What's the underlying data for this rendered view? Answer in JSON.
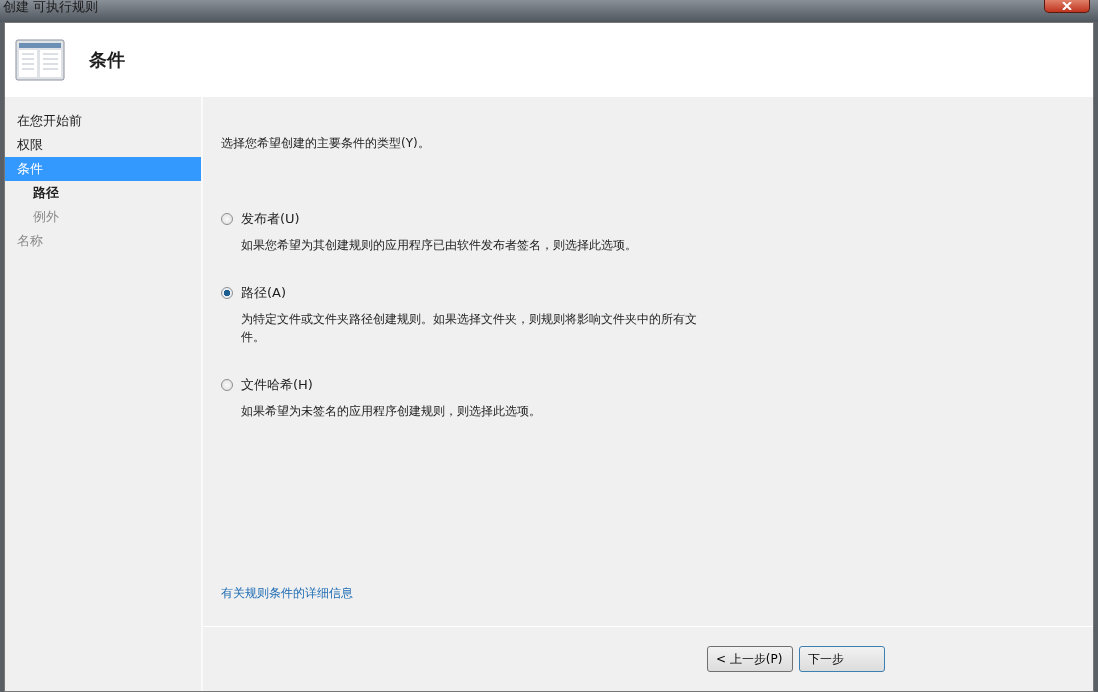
{
  "window": {
    "title": "创建 可执行规则"
  },
  "header": {
    "title": "条件"
  },
  "sidebar": {
    "items": [
      {
        "label": "在您开始前",
        "selected": false,
        "disabled": false,
        "current": false
      },
      {
        "label": "权限",
        "selected": false,
        "disabled": false,
        "current": false
      },
      {
        "label": "条件",
        "selected": true,
        "disabled": false,
        "current": false,
        "children": [
          {
            "label": "路径",
            "selected": false,
            "disabled": false,
            "current": true
          },
          {
            "label": "例外",
            "selected": false,
            "disabled": true,
            "current": false
          }
        ]
      },
      {
        "label": "名称",
        "selected": false,
        "disabled": true,
        "current": false
      }
    ]
  },
  "content": {
    "prompt": "选择您希望创建的主要条件的类型(Y)。",
    "options": [
      {
        "label": "发布者(U)",
        "selected": false,
        "description": "如果您希望为其创建规则的应用程序已由软件发布者签名，则选择此选项。"
      },
      {
        "label": "路径(A)",
        "selected": true,
        "description": "为特定文件或文件夹路径创建规则。如果选择文件夹，则规则将影响文件夹中的所有文件。"
      },
      {
        "label": "文件哈希(H)",
        "selected": false,
        "description": "如果希望为未签名的应用程序创建规则，则选择此选项。"
      }
    ],
    "help_link": "有关规则条件的详细信息"
  },
  "buttons": [
    {
      "label": "< 上一步(P)",
      "default": false
    },
    {
      "label": "下一步",
      "default": true
    }
  ]
}
